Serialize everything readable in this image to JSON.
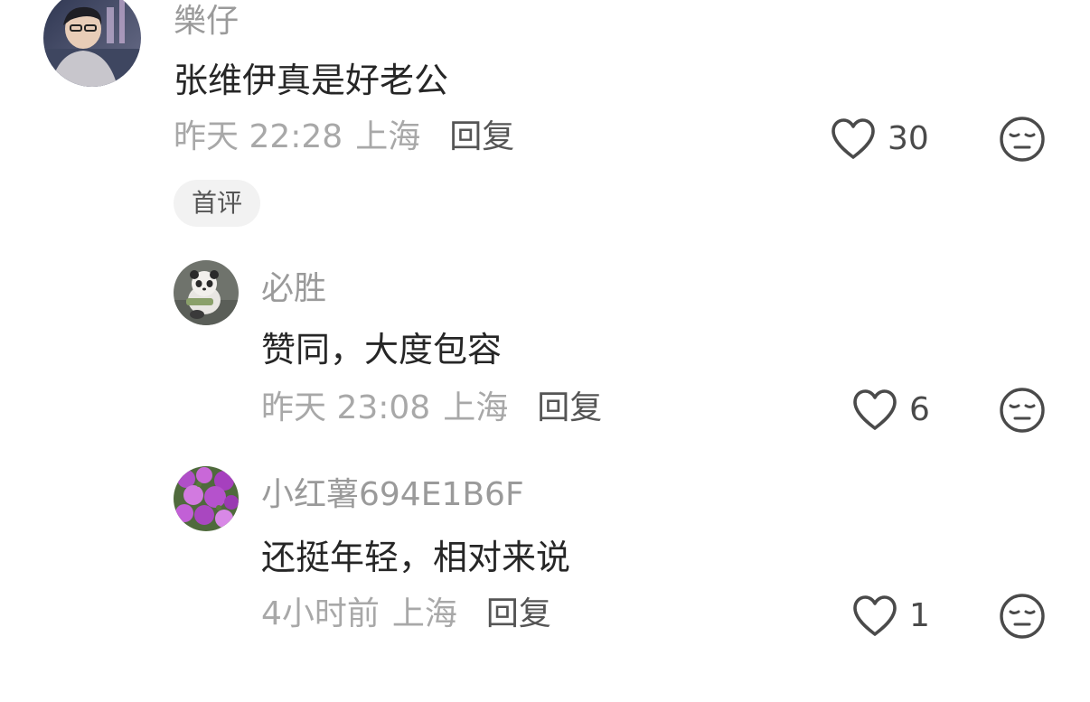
{
  "comments": [
    {
      "username": "樂仔",
      "content": "张维伊真是好老公",
      "time": "昨天 22:28",
      "location": "上海",
      "reply_label": "回复",
      "likes": "30",
      "badge": "首评"
    },
    {
      "username": "必胜",
      "content": "赞同，大度包容",
      "time": "昨天 23:08",
      "location": "上海",
      "reply_label": "回复",
      "likes": "6"
    },
    {
      "username": "小红薯694E1B6F",
      "content": "还挺年轻，相对来说",
      "time": "4小时前",
      "location": "上海",
      "reply_label": "回复",
      "likes": "1"
    }
  ],
  "icons": {
    "like": "heart-outline-icon",
    "dislike": "unamused-face-icon"
  },
  "colors": {
    "username": "#9a9a9a",
    "content": "#262626",
    "meta": "#a8a8a8",
    "reply": "#555555",
    "badge_bg": "#f2f2f2"
  }
}
